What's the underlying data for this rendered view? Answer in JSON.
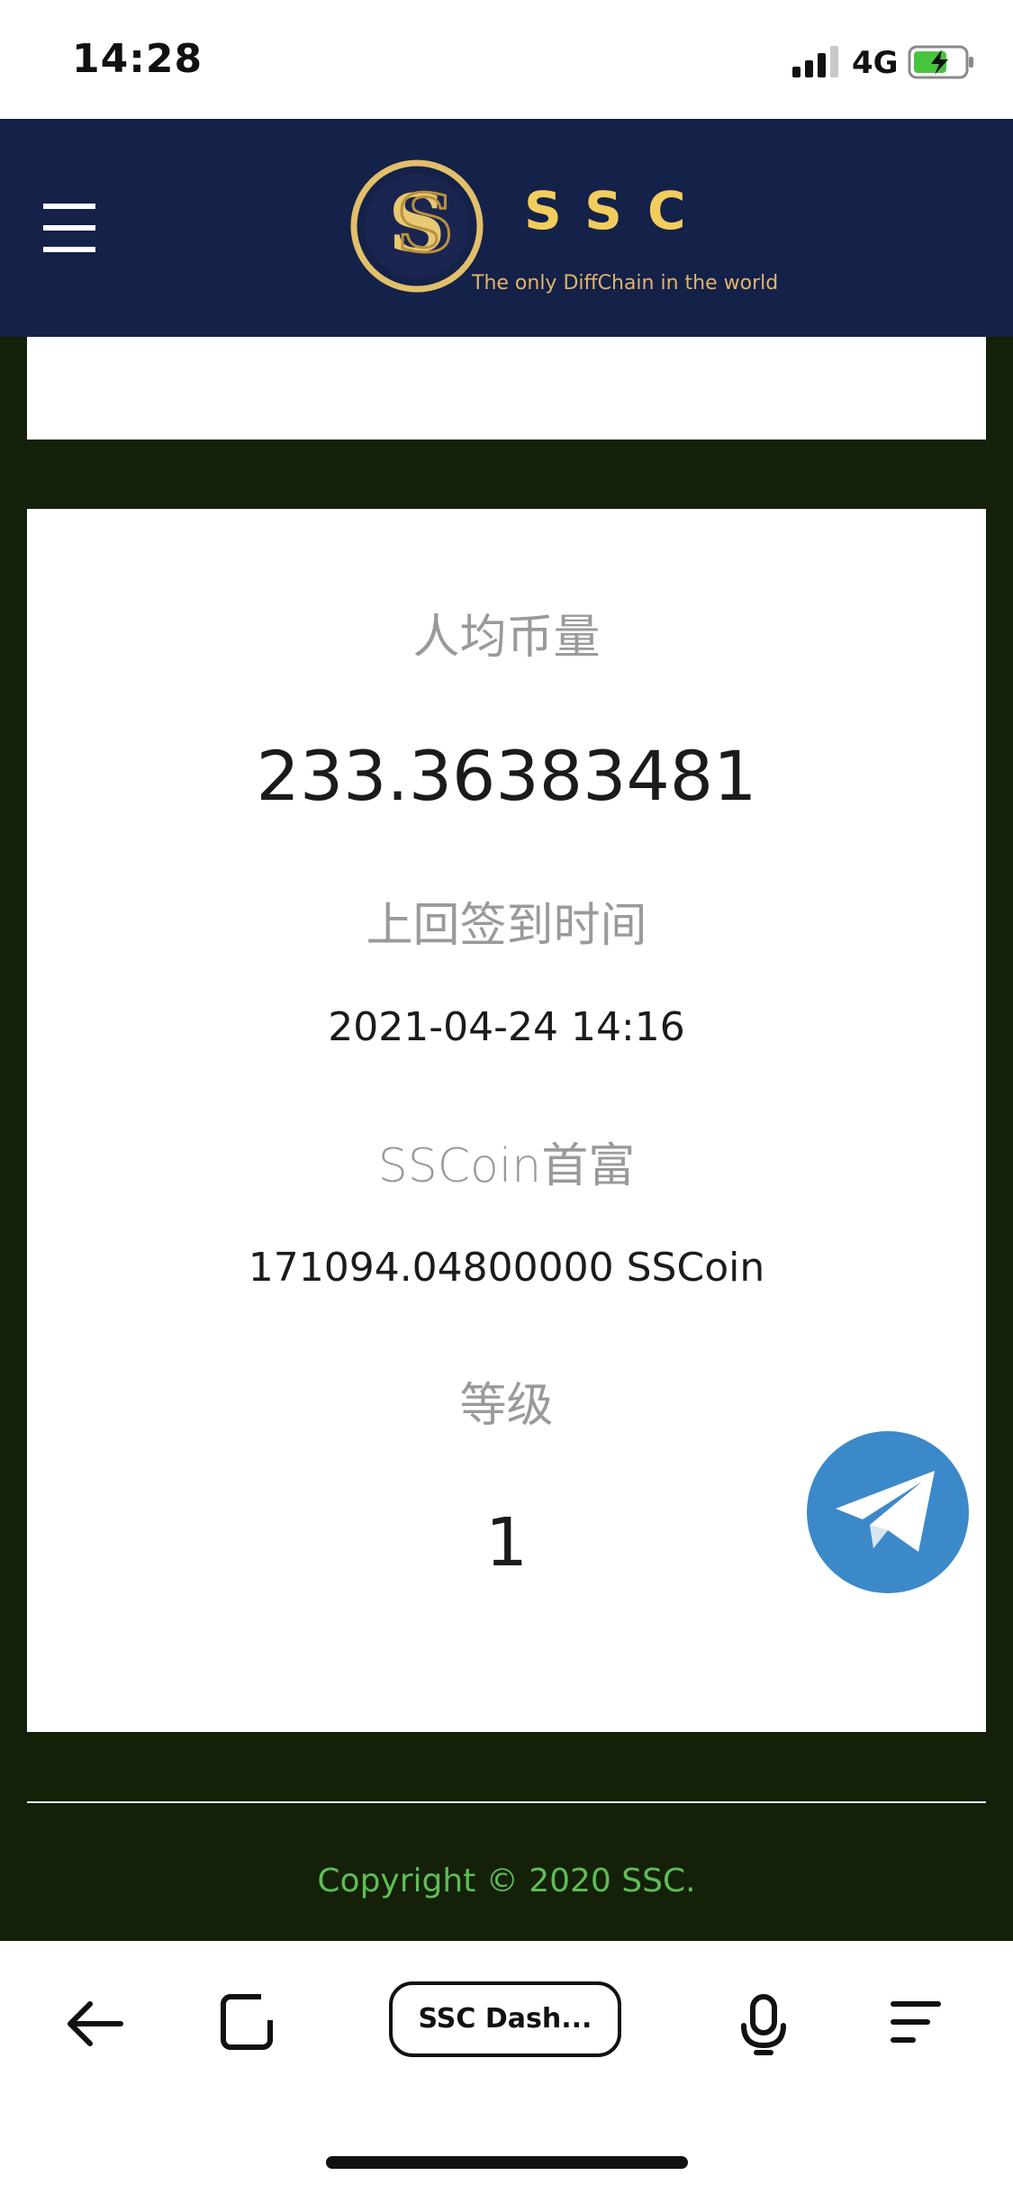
{
  "status_bar": {
    "time": "14:28",
    "network": "4G",
    "signal_icon": "signal-bars-icon",
    "battery_icon": "battery-charging-icon"
  },
  "header": {
    "brand": "SSC",
    "tagline": "The only DiffChain in the world",
    "menu_icon": "hamburger-menu-icon",
    "logo_icon": "ssc-coin-logo-icon",
    "background": "#142148",
    "brand_color": "#f0cd5c"
  },
  "stats": {
    "avg_coin_label": "人均币量",
    "avg_coin_value": "233.36383481",
    "last_checkin_label": "上回签到时间",
    "last_checkin_value": "2021-04-24 14:16",
    "richest_label": "SSCoin首富",
    "richest_value": "171094.04800000 SSCoin",
    "level_label": "等级",
    "level_value": "1"
  },
  "telegram": {
    "icon": "telegram-icon",
    "color": "#3c89c9"
  },
  "footer": {
    "copyright": "Copyright © 2020 SSC.",
    "copyright_color": "#5ebd54"
  },
  "browser": {
    "tab_title": "SSC Dash...",
    "back_icon": "back-arrow-icon",
    "tabs_icon": "tabs-icon",
    "mic_icon": "microphone-icon",
    "menu_icon": "menu-lines-icon"
  },
  "colors": {
    "page_background": "#142008",
    "label_gray": "#9a9a9a",
    "value_dark": "#1b1b1b"
  }
}
